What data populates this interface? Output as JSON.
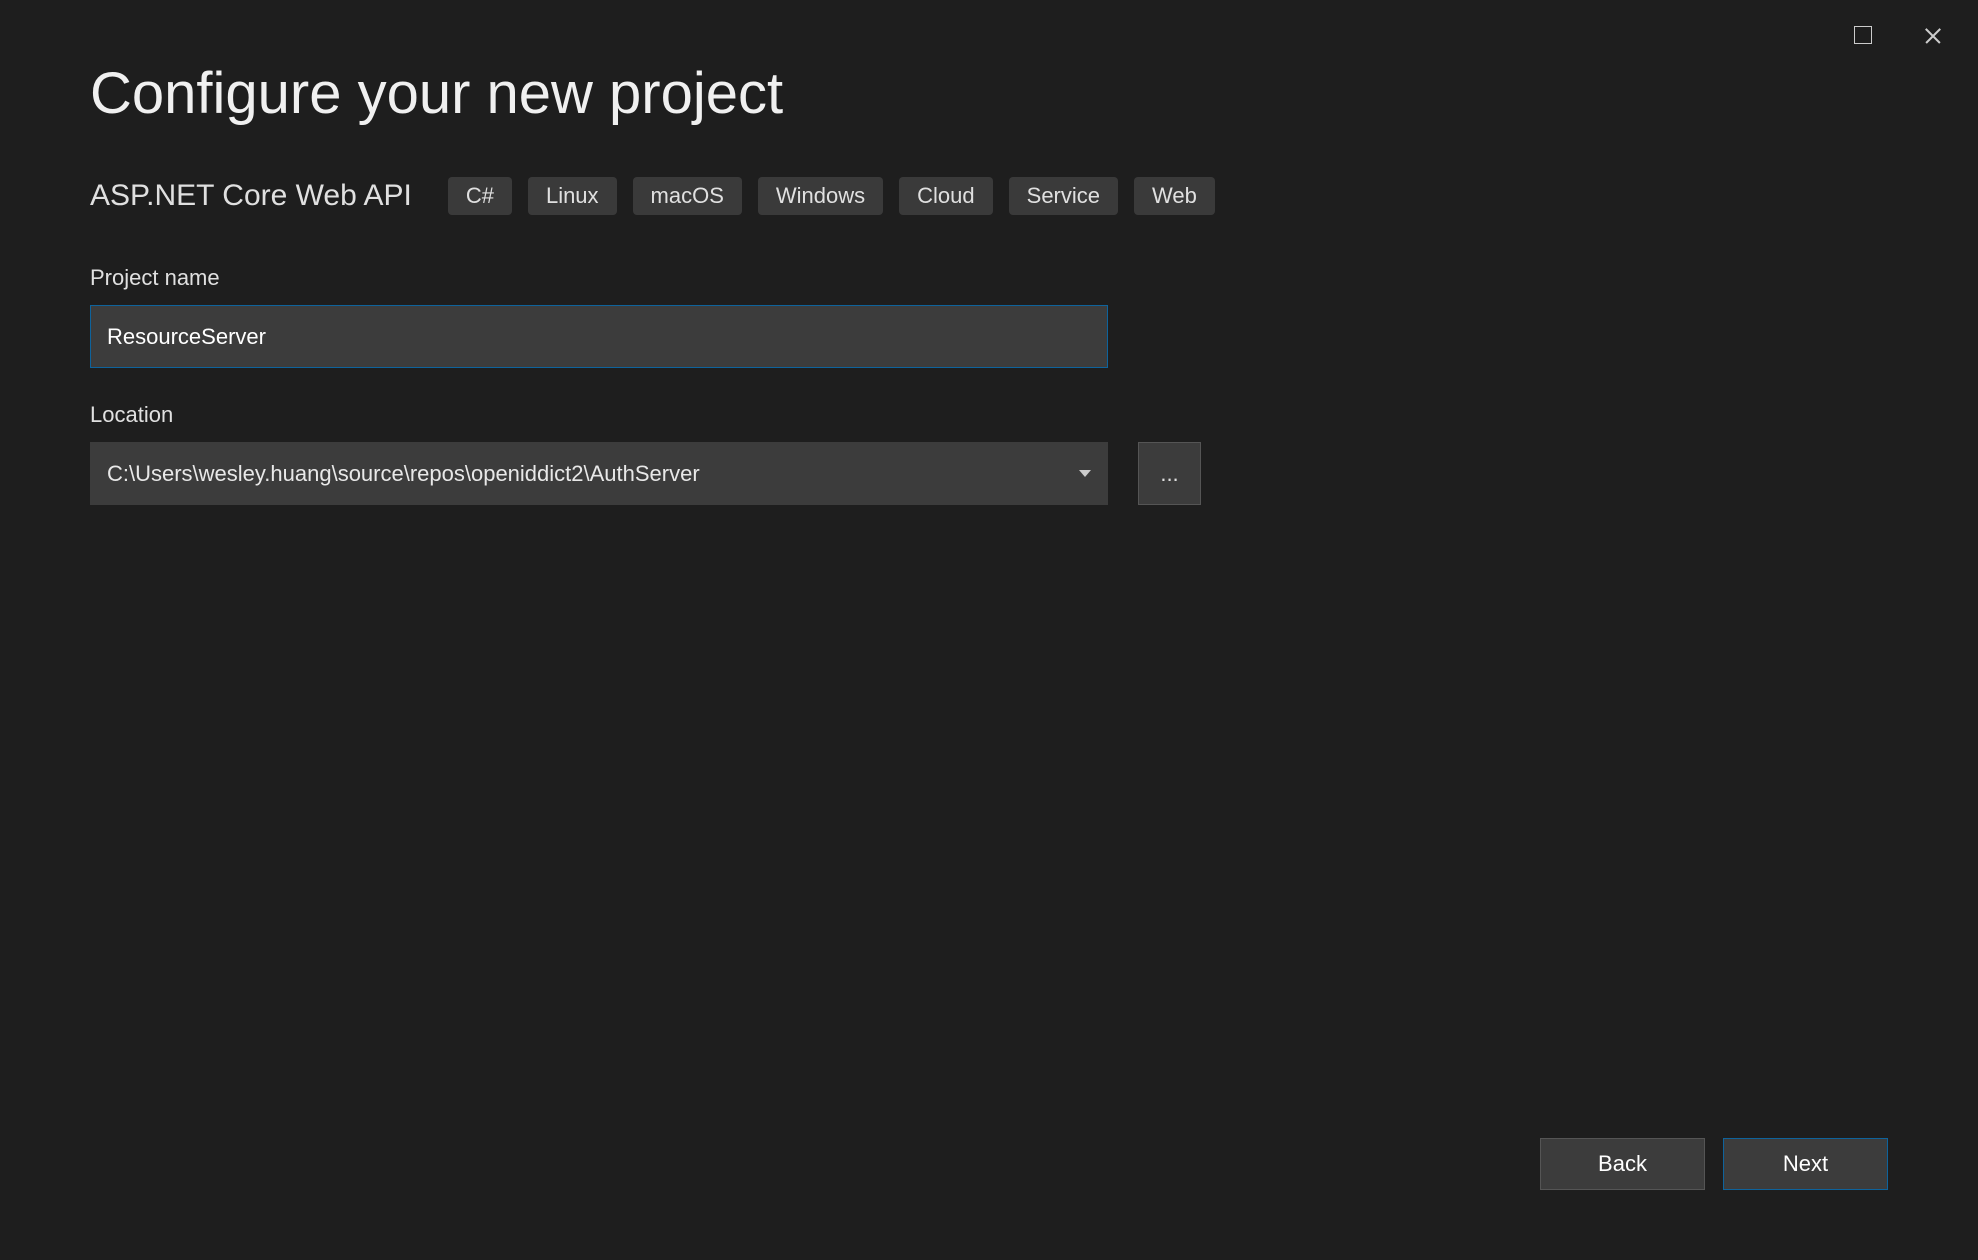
{
  "window": {
    "maximize_label": "Maximize",
    "close_label": "Close"
  },
  "page": {
    "title": "Configure your new project"
  },
  "template": {
    "name": "ASP.NET Core Web API",
    "tags": [
      "C#",
      "Linux",
      "macOS",
      "Windows",
      "Cloud",
      "Service",
      "Web"
    ]
  },
  "fields": {
    "project_name_label": "Project name",
    "project_name_value": "ResourceServer",
    "location_label": "Location",
    "location_value": "C:\\Users\\wesley.huang\\source\\repos\\openiddict2\\AuthServer",
    "browse_label": "..."
  },
  "footer": {
    "back_label": "Back",
    "next_label": "Next"
  }
}
